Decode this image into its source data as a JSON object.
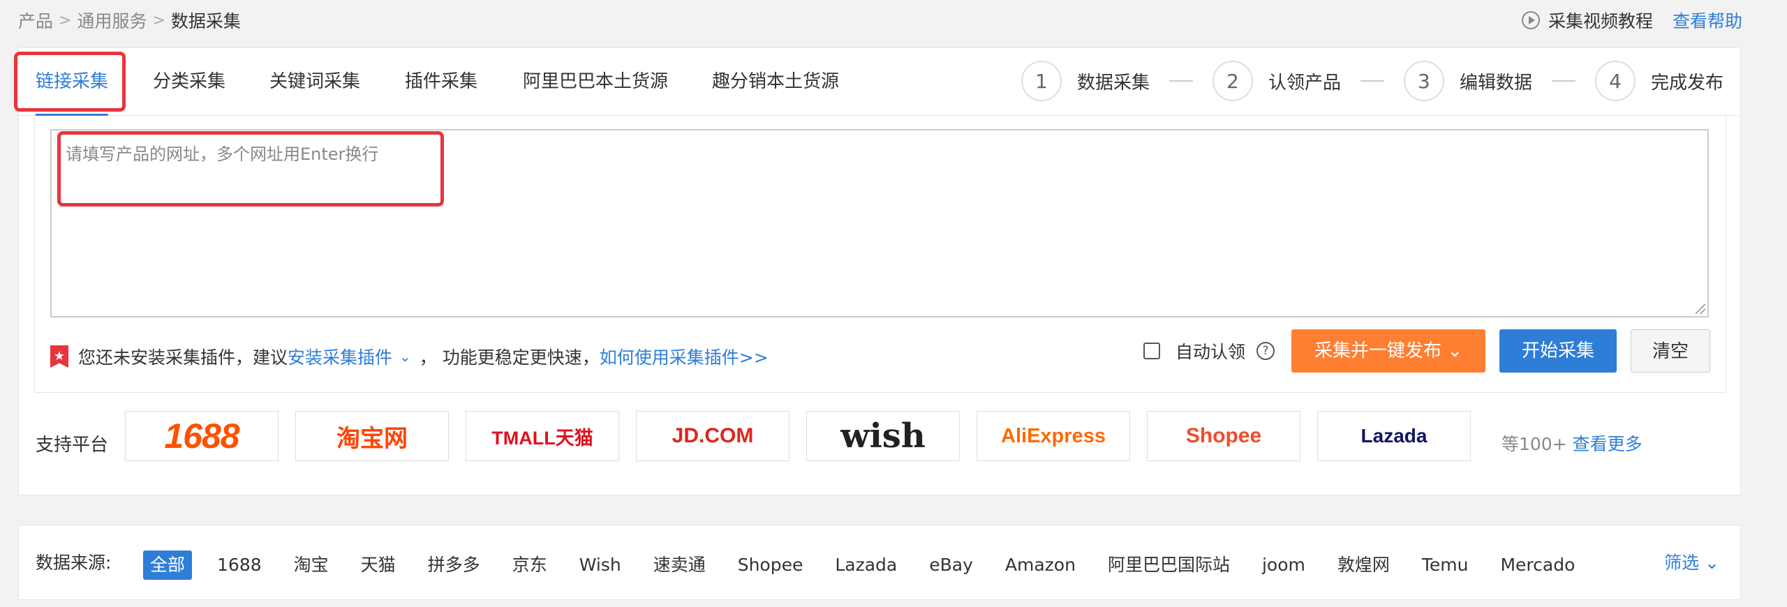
{
  "breadcrumb": [
    "产品",
    "通用服务",
    "数据采集"
  ],
  "breadcrumb_separator": ">",
  "help": {
    "video_label": "采集视频教程",
    "help_link": "查看帮助"
  },
  "tabs": [
    "链接采集",
    "分类采集",
    "关键词采集",
    "插件采集",
    "阿里巴巴本土货源",
    "趣分销本土货源"
  ],
  "steps": [
    {
      "num": "1",
      "label": "数据采集"
    },
    {
      "num": "2",
      "label": "认领产品"
    },
    {
      "num": "3",
      "label": "编辑数据"
    },
    {
      "num": "4",
      "label": "完成发布"
    }
  ],
  "url_input": {
    "placeholder": "请填写产品的网址，多个网址用Enter换行"
  },
  "plugin_tip": {
    "text1": "您还未安装采集插件，建议",
    "install_link": "安装采集插件",
    "text2": "，  功能更稳定更快速，",
    "howto_link": "如何使用采集插件>>"
  },
  "controls": {
    "auto_claim": "自动认领",
    "collect_publish": "采集并一键发布",
    "start": "开始采集",
    "clear": "清空"
  },
  "platforms": {
    "label": "支持平台",
    "logos": [
      "1688",
      "淘宝网",
      "TMALL天猫",
      "JD.COM",
      "wish",
      "AliExpress",
      "Shopee",
      "Lazada"
    ],
    "more_text": "等100+",
    "more_link": "查看更多"
  },
  "sources": {
    "label": "数据来源:",
    "items": [
      "全部",
      "1688",
      "淘宝",
      "天猫",
      "拼多多",
      "京东",
      "Wish",
      "速卖通",
      "Shopee",
      "Lazada",
      "eBay",
      "Amazon",
      "阿里巴巴国际站",
      "joom",
      "敦煌网",
      "Temu",
      "Mercado"
    ],
    "filter": "筛选"
  },
  "colors": {
    "accent": "#2e7ed8",
    "orange": "#ff7f32",
    "highlight": "#e8353c"
  }
}
